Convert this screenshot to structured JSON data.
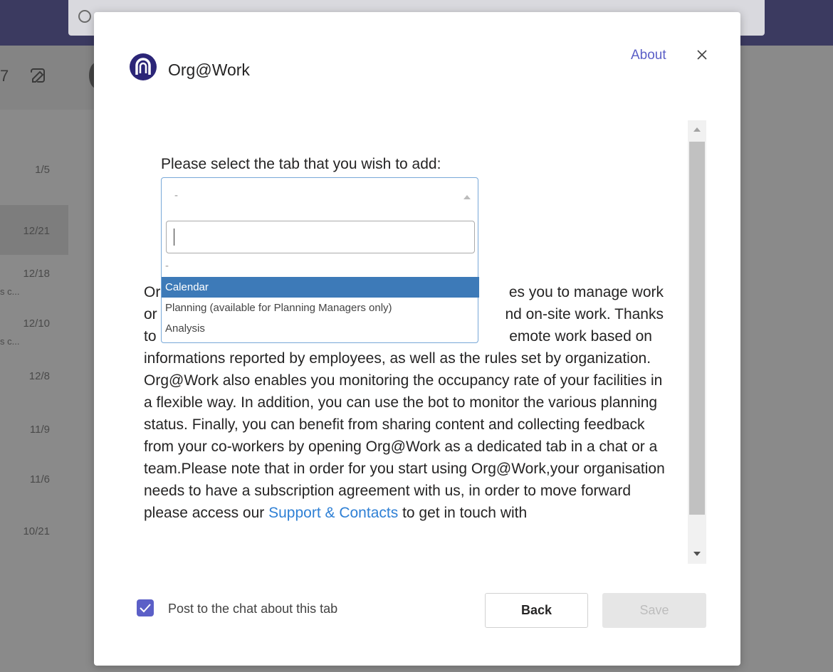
{
  "background": {
    "dates": [
      "1/5",
      "12/21",
      "12/18",
      "12/10",
      "12/8",
      "11/9",
      "11/6",
      "10/21"
    ],
    "snippets": [
      "s c...",
      "s c..."
    ]
  },
  "dialog": {
    "app_name": "Org@Work",
    "about_label": "About",
    "select_label": "Please select the tab that you wish to add:",
    "select_value": "-",
    "dropdown_search_value": "",
    "options": [
      {
        "label": "-",
        "highlighted": false
      },
      {
        "label": "Calendar",
        "highlighted": true
      },
      {
        "label": "Planning (available for Planning Managers only)",
        "highlighted": false
      },
      {
        "label": "Analysis",
        "highlighted": false
      }
    ],
    "description_line1": "Or",
    "description_line1_tail": "es you to manage work",
    "description_line2": "or",
    "description_line2_tail": "nd on-site work. Thanks",
    "description_line3": "to",
    "description_line3_tail": "emote work based on",
    "description_rest": "informations reported by employees, as well as the rules set by organization. Org@Work also enables you monitoring the occupancy rate of your facilities in a flexible way. In addition, you can use the bot to monitor the various planning status. Finally, you can benefit from sharing content and collecting feedback from your co-workers by opening Org@Work as a dedicated tab in a chat or a team.Please note that in order for you start using Org@Work,your organisation needs to have a subscription agreement with us, in order to move forward please access our",
    "support_link": "Support & Contacts",
    "description_after_link": "to get in touch with",
    "post_checkbox_label": "Post to the chat about this tab",
    "post_checked": true,
    "back_label": "Back",
    "save_label": "Save"
  },
  "colors": {
    "accent": "#5b5fc7",
    "logo": "#2b2577",
    "highlight": "#3d7ab8",
    "link": "#2f80d5"
  }
}
